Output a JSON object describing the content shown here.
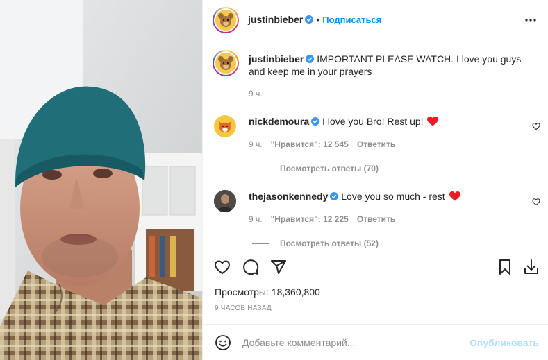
{
  "post": {
    "author": "justinbieber",
    "follow_label": "Подписаться",
    "more_icon": "more-horizontal-icon",
    "caption": "IMPORTANT PLEASE WATCH. I love you guys and keep me in your prayers",
    "caption_time": "9 ч."
  },
  "comments": [
    {
      "user": "nickdemoura",
      "text": "I love you Bro! Rest up!",
      "time": "9 ч.",
      "likes": "\"Нравится\": 12 545",
      "reply_label": "Ответить",
      "view_replies": "Посмотреть ответы (70)"
    },
    {
      "user": "thejasonkennedy",
      "text": "Love you so much - rest",
      "time": "9 ч.",
      "likes": "\"Нравится\": 12 225",
      "reply_label": "Ответить",
      "view_replies": "Посмотреть ответы (52)"
    }
  ],
  "stats": {
    "views": "Просмотры: 18,360,800",
    "posted_ago": "9 ЧАСОВ НАЗАД"
  },
  "add_comment": {
    "placeholder": "Добавьте комментарий...",
    "publish_label": "Опубликовать"
  },
  "colors": {
    "accent": "#0095f6",
    "verified": "#3897f0",
    "heart_red": "#ed4956",
    "muted": "#8e8e8e",
    "publish_disabled": "#b2dffc"
  }
}
